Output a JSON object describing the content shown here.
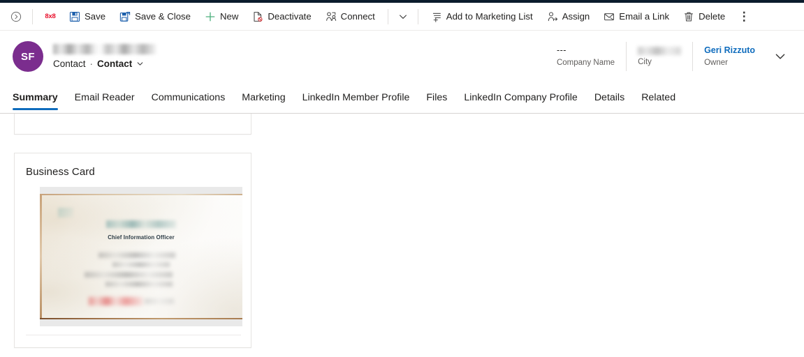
{
  "command_bar": {
    "expand_icon": "chevron-right-circle-icon",
    "app_logo": "8x8",
    "items": [
      {
        "label": "Save",
        "icon": "save-floppy-icon"
      },
      {
        "label": "Save & Close",
        "icon": "save-and-close-icon"
      },
      {
        "label": "New",
        "icon": "plus-icon"
      },
      {
        "label": "Deactivate",
        "icon": "deactivate-document-icon"
      },
      {
        "label": "Connect",
        "icon": "connect-people-icon"
      }
    ],
    "split_caret": "chevron-down-icon",
    "items_right": [
      {
        "label": "Add to Marketing List",
        "icon": "add-to-list-icon"
      },
      {
        "label": "Assign",
        "icon": "assign-person-icon"
      },
      {
        "label": "Email a Link",
        "icon": "email-link-icon"
      },
      {
        "label": "Delete",
        "icon": "trash-icon"
      }
    ],
    "overflow_label": "⋮"
  },
  "record_header": {
    "avatar_initials": "SF",
    "record_name": "",
    "entity_label": "Contact",
    "separator": "·",
    "form_label": "Contact",
    "form_chevron": "chevron-down-icon",
    "fields": [
      {
        "value": "---",
        "label": "Company Name",
        "blurred": false,
        "link": false
      },
      {
        "value": "",
        "label": "City",
        "blurred": true,
        "link": false
      },
      {
        "value": "Geri Rizzuto",
        "label": "Owner",
        "blurred": false,
        "link": true
      }
    ],
    "more_chevron": "chevron-down-icon"
  },
  "tabs": {
    "active": "Summary",
    "items": [
      "Summary",
      "Email Reader",
      "Communications",
      "Marketing",
      "LinkedIn Member Profile",
      "Files",
      "LinkedIn Company Profile",
      "Details",
      "Related"
    ]
  },
  "content": {
    "business_card_section": {
      "title": "Business Card",
      "image": {
        "visible_text": "Chief Information Officer",
        "redacted_name_line": true,
        "redacted_detail_lines": 4,
        "redacted_red_line": true
      }
    }
  },
  "colors": {
    "accent": "#0f6cbd",
    "avatar": "#7b2d8e",
    "logo_red": "#e8112d",
    "new_green": "#4caf7d",
    "top_strip": "#0b1c2c",
    "border": "#e1dfdd"
  }
}
